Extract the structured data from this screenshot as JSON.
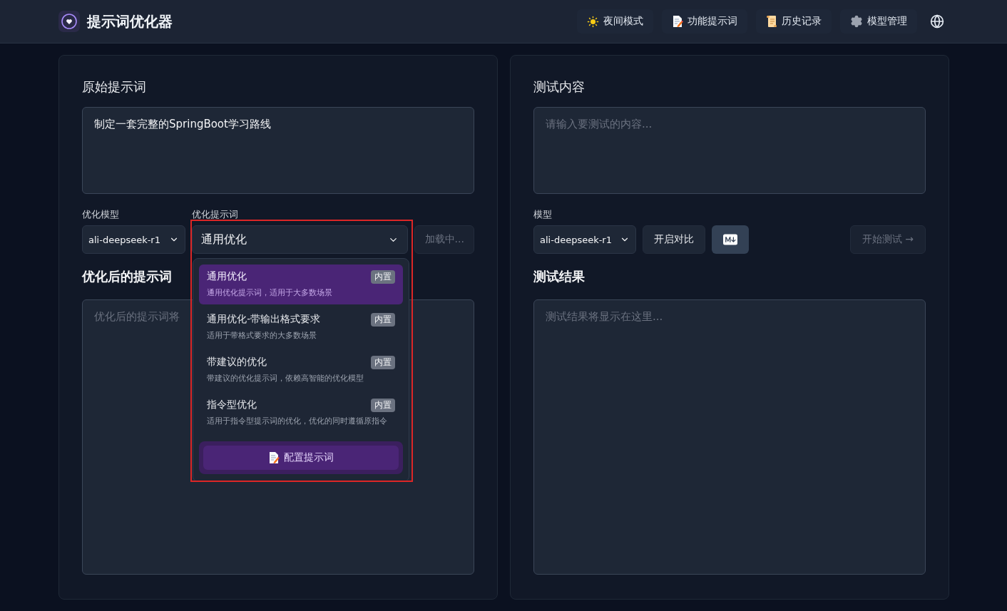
{
  "header": {
    "title": "提示词优化器",
    "nav": [
      {
        "label": "夜间模式",
        "kind": "theme"
      },
      {
        "label": "功能提示词",
        "kind": "prompts"
      },
      {
        "label": "历史记录",
        "kind": "history"
      },
      {
        "label": "模型管理",
        "kind": "models"
      }
    ]
  },
  "left_panel": {
    "title": "原始提示词",
    "input": {
      "value": "制定一套完整的SpringBoot学习路线"
    },
    "model_select": {
      "label": "优化模型",
      "value": "ali-deepseek-r1"
    },
    "prompt_select": {
      "label": "优化提示词",
      "value": "通用优化",
      "expanded": true,
      "options": [
        {
          "name": "通用优化",
          "description": "通用优化提示词，适用于大多数场景",
          "badge": "内置",
          "selected": true
        },
        {
          "name": "通用优化-带输出格式要求",
          "description": "适用于带格式要求的大多数场景",
          "badge": "内置",
          "selected": false
        },
        {
          "name": "带建议的优化",
          "description": "带建议的优化提示词，依赖高智能的优化模型",
          "badge": "内置",
          "selected": false
        },
        {
          "name": "指令型优化",
          "description": "适用于指令型提示词的优化，优化的同时遵循原指令",
          "badge": "内置",
          "selected": false
        }
      ],
      "footer_button": "配置提示词"
    },
    "loading_button": {
      "label": "加载中...",
      "disabled": true
    },
    "output": {
      "title": "优化后的提示词",
      "placeholder": "优化后的提示词将"
    }
  },
  "right_panel": {
    "title": "测试内容",
    "input": {
      "placeholder": "请输入要测试的内容..."
    },
    "model_select": {
      "label": "模型",
      "value": "ali-deepseek-r1"
    },
    "compare_button": "开启对比",
    "start_button": {
      "label": "开始测试 →",
      "disabled": true
    },
    "result": {
      "title": "测试结果",
      "placeholder": "测试结果将显示在这里..."
    }
  }
}
